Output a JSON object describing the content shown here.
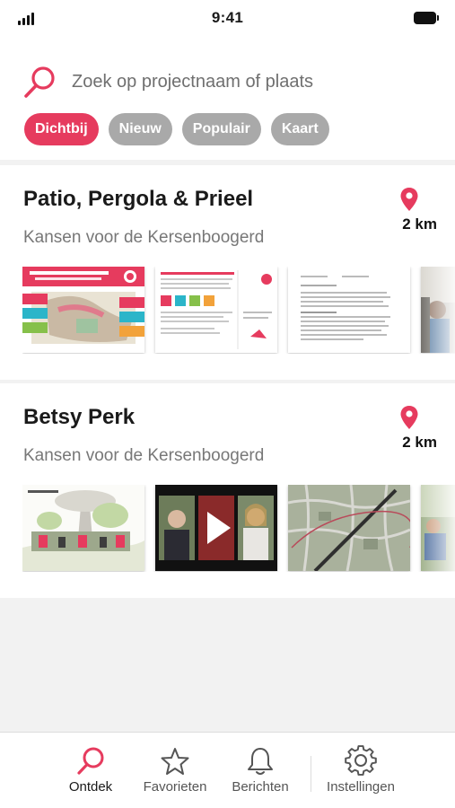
{
  "status_bar": {
    "time": "9:41"
  },
  "search": {
    "placeholder": "Zoek op projectnaam of plaats"
  },
  "filters": [
    {
      "label": "Dichtbij",
      "active": true
    },
    {
      "label": "Nieuw",
      "active": false
    },
    {
      "label": "Populair",
      "active": false
    },
    {
      "label": "Kaart",
      "active": false
    }
  ],
  "projects": [
    {
      "title": "Patio, Pergola & Prieel",
      "subtitle": "Kansen voor de Kersenboogerd",
      "distance": "2 km",
      "thumbnails": [
        "poster-thumbnail",
        "document-thumbnail",
        "letter-thumbnail",
        "photo-thumbnail"
      ]
    },
    {
      "title": "Betsy Perk",
      "subtitle": "Kansen voor de Kersenboogerd",
      "distance": "2 km",
      "thumbnails": [
        "sketch-thumbnail",
        "video-thumbnail",
        "map-thumbnail",
        "photo-thumbnail"
      ]
    }
  ],
  "tabbar": {
    "items": [
      {
        "label": "Ontdek",
        "icon": "search-icon",
        "active": true
      },
      {
        "label": "Favorieten",
        "icon": "star-icon",
        "active": false
      },
      {
        "label": "Berichten",
        "icon": "bell-icon",
        "active": false
      },
      {
        "label": "Instellingen",
        "icon": "gear-icon",
        "active": false
      }
    ]
  },
  "colors": {
    "accent": "#e63b5e",
    "chip_inactive": "#a9a9a9",
    "background": "#f2f2f2"
  }
}
